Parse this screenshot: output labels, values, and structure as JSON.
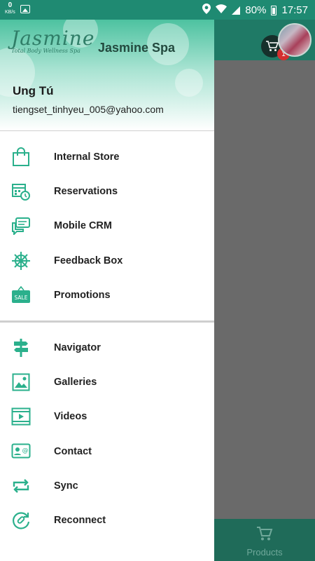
{
  "status_bar": {
    "speed_value": "0",
    "speed_unit": "KB/s",
    "battery": "80%",
    "time": "17:57"
  },
  "background_app": {
    "cart_badge": "1",
    "bottom_tab_label": "Products"
  },
  "drawer": {
    "logo_text": "Jasmine",
    "logo_tagline": "Total Body Wellness Spa",
    "spa_name": "Jasmine Spa",
    "user_name": "Ung Tú",
    "user_email": "tiengset_tinhyeu_005@yahoo.com",
    "section1": [
      {
        "icon": "shopping-bag-icon",
        "label": "Internal Store"
      },
      {
        "icon": "calendar-clock-icon",
        "label": "Reservations"
      },
      {
        "icon": "chat-bubbles-icon",
        "label": "Mobile CRM"
      },
      {
        "icon": "ship-wheel-icon",
        "label": "Feedback Box"
      },
      {
        "icon": "sale-tag-icon",
        "label": "Promotions",
        "icon_text": "SALE"
      }
    ],
    "section2": [
      {
        "icon": "signpost-icon",
        "label": "Navigator"
      },
      {
        "icon": "image-gallery-icon",
        "label": "Galleries"
      },
      {
        "icon": "video-film-icon",
        "label": "Videos"
      },
      {
        "icon": "contact-card-icon",
        "label": "Contact"
      },
      {
        "icon": "sync-arrows-icon",
        "label": "Sync"
      },
      {
        "icon": "reconnect-link-icon",
        "label": "Reconnect"
      }
    ]
  },
  "colors": {
    "accent": "#2bb08c",
    "status_bar": "#1f8a72",
    "scrim": "#6a6a6a"
  }
}
